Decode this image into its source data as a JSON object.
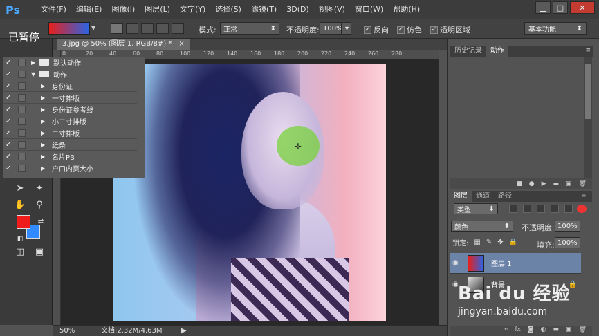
{
  "app": {
    "logo": "Ps"
  },
  "menu": [
    "文件(F)",
    "编辑(E)",
    "图像(I)",
    "图层(L)",
    "文字(Y)",
    "选择(S)",
    "滤镜(T)",
    "3D(D)",
    "视图(V)",
    "窗口(W)",
    "帮助(H)"
  ],
  "window_controls": {
    "minimize": "▁",
    "restore": "□",
    "close": "✕"
  },
  "options": {
    "paused": "已暂停",
    "mode_label": "模式:",
    "mode_value": "正常",
    "opacity_label": "不透明度:",
    "opacity_value": "100%",
    "reverse_label": "反向",
    "dither_label": "仿色",
    "transparency_label": "透明区域",
    "workspace": "基本功能",
    "gradient_colors": [
      "#e8201a",
      "#2a64e6"
    ]
  },
  "document": {
    "tab_title": "3.jpg @ 50% (图层 1, RGB/8#) *",
    "tab_close": "×",
    "ruler_ticks": [
      "0",
      "20",
      "40",
      "60",
      "80",
      "100",
      "120",
      "140",
      "160",
      "180",
      "200",
      "220",
      "240",
      "260",
      "280"
    ],
    "zoom": "50%",
    "doc_info": "文档:2.32M/4.63M"
  },
  "tools": {
    "fg_color": "#f01c1c",
    "bg_color": "#2f8bff"
  },
  "history_panel": {
    "tabs": [
      "历史记录",
      "动作"
    ],
    "items": [
      {
        "label": "默认动作",
        "folder": true,
        "expanded": false
      },
      {
        "label": "动作",
        "folder": true,
        "expanded": true
      },
      {
        "label": "身份证",
        "folder": false
      },
      {
        "label": "一寸排版",
        "folder": false
      },
      {
        "label": "身份证参考线",
        "folder": false
      },
      {
        "label": "小二寸排版",
        "folder": false
      },
      {
        "label": "二寸排版",
        "folder": false
      },
      {
        "label": "纸条",
        "folder": false
      },
      {
        "label": "名片PB",
        "folder": false
      },
      {
        "label": "户口内页大小",
        "folder": false
      }
    ]
  },
  "layers_panel": {
    "tabs": [
      "图层",
      "通道",
      "路径"
    ],
    "filter": "类型",
    "blend_mode": "颜色",
    "opacity_label": "不透明度:",
    "opacity_value": "100%",
    "lock_label": "锁定:",
    "fill_label": "填充:",
    "fill_value": "100%",
    "layers": [
      {
        "name": "图层 1",
        "selected": true
      },
      {
        "name": "背景",
        "selected": false
      }
    ]
  },
  "watermark": {
    "logo": "Bai du 经验",
    "url": "jingyan.baidu.com"
  }
}
